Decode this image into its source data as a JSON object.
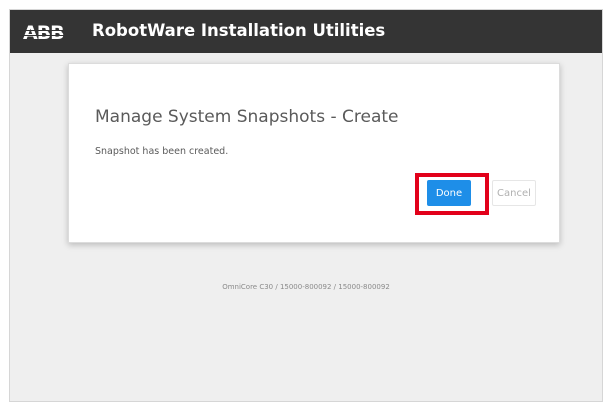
{
  "header": {
    "logo": "ABB",
    "title": "RobotWare Installation Utilities"
  },
  "dialog": {
    "title": "Manage System Snapshots - Create",
    "message": "Snapshot has been created.",
    "done_label": "Done",
    "cancel_label": "Cancel"
  },
  "footer": {
    "info": "OmniCore C30 / 15000-800092 / 15000-800092"
  },
  "colors": {
    "header_bg": "#343434",
    "primary_button": "#1e8ee8",
    "highlight": "#e2001a",
    "background": "#efefef"
  }
}
